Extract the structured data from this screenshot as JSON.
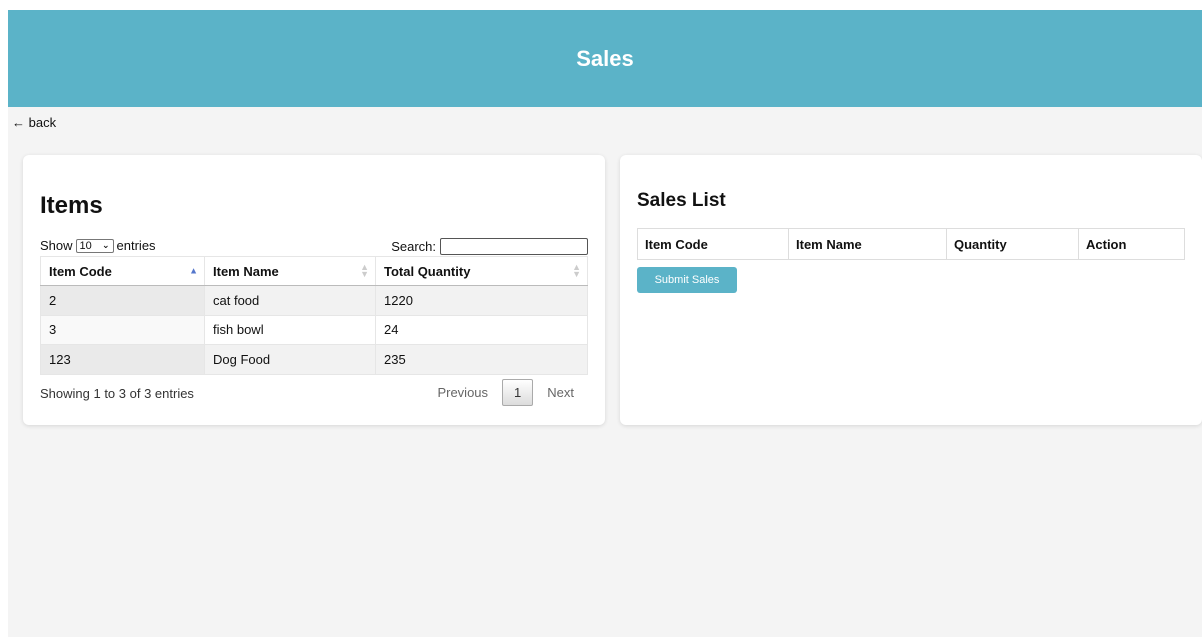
{
  "header": {
    "title": "Sales"
  },
  "nav": {
    "back_label": "← back"
  },
  "items_panel": {
    "title": "Items",
    "length": {
      "prefix": "Show",
      "value": "10",
      "suffix": "entries"
    },
    "search": {
      "label": "Search:",
      "value": ""
    },
    "columns": [
      "Item Code",
      "Item Name",
      "Total Quantity"
    ],
    "rows": [
      [
        "2",
        "cat food",
        "1220"
      ],
      [
        "3",
        "fish bowl",
        "24"
      ],
      [
        "123",
        "Dog Food",
        "235"
      ]
    ],
    "info": "Showing 1 to 3 of 3 entries",
    "paging": {
      "previous": "Previous",
      "current": "1",
      "next": "Next"
    }
  },
  "sales_panel": {
    "title": "Sales List",
    "columns": [
      "Item Code",
      "Item Name",
      "Quantity",
      "Action"
    ],
    "submit_label": "Submit Sales"
  },
  "colors": {
    "accent": "#5bb3c8",
    "background": "#f4f4f4"
  }
}
